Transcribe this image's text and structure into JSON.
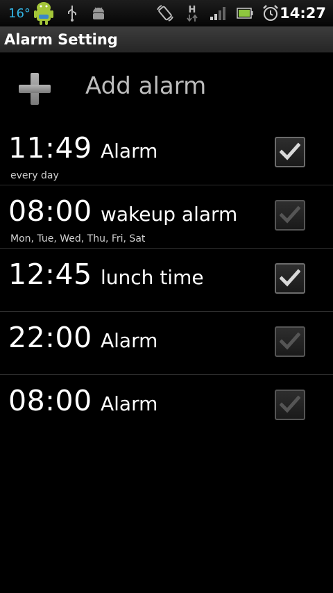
{
  "status_bar": {
    "temperature": "16°",
    "time": "14:27",
    "network_label": "H"
  },
  "header": {
    "title": "Alarm Setting"
  },
  "add_alarm": {
    "label": "Add alarm"
  },
  "alarms": [
    {
      "time": "11:49",
      "label": "Alarm",
      "days": "every day",
      "enabled": true
    },
    {
      "time": "08:00",
      "label": "wakeup alarm",
      "days": "Mon, Tue, Wed, Thu, Fri, Sat",
      "enabled": false
    },
    {
      "time": "12:45",
      "label": "lunch time",
      "days": "",
      "enabled": true
    },
    {
      "time": "22:00",
      "label": "Alarm",
      "days": "",
      "enabled": false
    },
    {
      "time": "08:00",
      "label": "Alarm",
      "days": "",
      "enabled": false
    }
  ],
  "colors": {
    "temperature": "#33b5e5",
    "check_on": "#d9d9d9",
    "check_off": "#555555"
  }
}
